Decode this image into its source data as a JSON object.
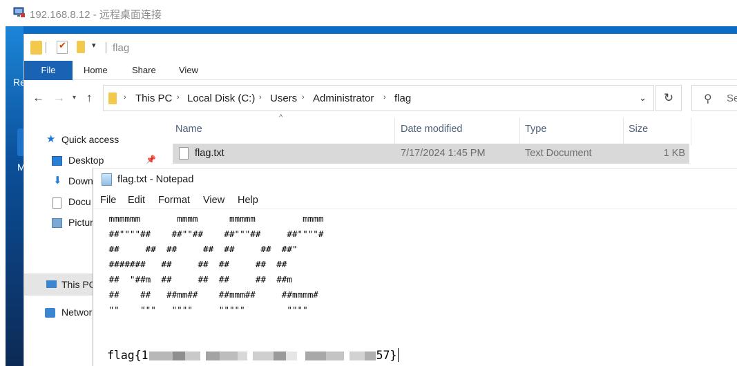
{
  "rdp": {
    "title": "192.168.8.12 - 远程桌面连接"
  },
  "desktop": {
    "label_re": "Re",
    "label_m": "M"
  },
  "explorer": {
    "qa_title": "flag",
    "ribbon_tabs": [
      "File",
      "Home",
      "Share",
      "View"
    ],
    "breadcrumb": [
      "This PC",
      "Local Disk (C:)",
      "Users",
      "Administrator",
      "flag"
    ],
    "search_placeholder": "Se",
    "nav_items": {
      "quick_access": "Quick access",
      "desktop": "Desktop",
      "downloads": "Down",
      "documents": "Docu",
      "pictures": "Pictur",
      "this_pc": "This PC",
      "network": "Networ"
    },
    "columns": [
      "Name",
      "Date modified",
      "Type",
      "Size"
    ],
    "files": [
      {
        "name": "flag.txt",
        "date": "7/17/2024 1:45 PM",
        "type": "Text Document",
        "size": "1 KB"
      }
    ]
  },
  "notepad": {
    "title": "flag.txt - Notepad",
    "menu": [
      "File",
      "Edit",
      "Format",
      "View",
      "Help"
    ],
    "ascii_art": " mmmmmm       mmmm      mmmmm         mmmm\n ##\"\"\"\"##    ##\"\"##    ##\"\"\"##     ##\"\"\"\"#\n ##     ##  ##     ##  ##     ##  ##\"\n #######   ##     ##  ##     ##  ##\n ##  \"##m  ##     ##  ##     ##  ##m\n ##    ##   ##mm##    ##mmm##     ##mmmm#\n \"\"    \"\"\"   \"\"\"\"     \"\"\"\"\"        \"\"\"\"",
    "flag_prefix": "flag{1",
    "flag_suffix": "57}"
  },
  "colors": {
    "desktop_blue": "#0a6cc4",
    "ribbon_file_tab": "#1a63b4",
    "selected_row": "#d9d9d9",
    "column_header_text": "#4c607a"
  }
}
